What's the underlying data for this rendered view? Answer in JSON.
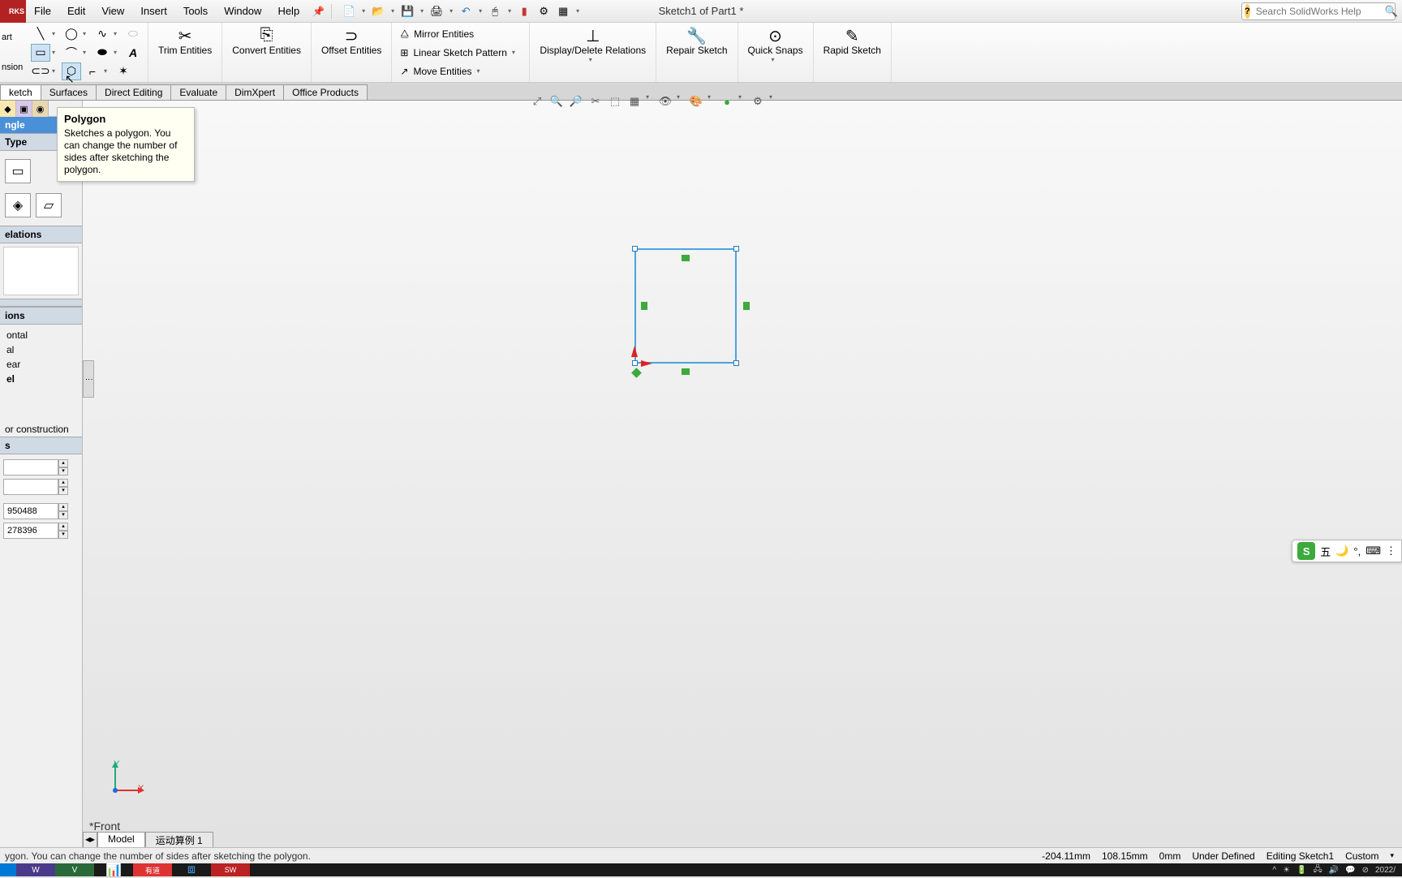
{
  "app": {
    "logo_text": "RKS",
    "document_title": "Sketch1 of Part1 *"
  },
  "menu": {
    "items": [
      "File",
      "Edit",
      "View",
      "Insert",
      "Tools",
      "Window",
      "Help"
    ]
  },
  "search": {
    "placeholder": "Search SolidWorks Help"
  },
  "ribbon": {
    "left_stub_top": "art",
    "left_stub_bottom": "nsion",
    "trim": "Trim Entities",
    "convert": "Convert Entities",
    "offset": "Offset Entities",
    "mirror": "Mirror Entities",
    "linear_pattern": "Linear Sketch Pattern",
    "move": "Move Entities",
    "display_delete": "Display/Delete Relations",
    "repair": "Repair Sketch",
    "quick_snaps": "Quick Snaps",
    "rapid": "Rapid Sketch"
  },
  "ribbon_tabs": [
    "ketch",
    "Surfaces",
    "Direct Editing",
    "Evaluate",
    "DimXpert",
    "Office Products"
  ],
  "tooltip": {
    "title": "Polygon",
    "body": "Sketches a polygon. You can change the number of sides after sketching the polygon."
  },
  "left_panel": {
    "header": "ngle",
    "type_section": "Type",
    "relations_section": "elations",
    "options_section": "ions",
    "opt_horizontal": "ontal",
    "opt_vertical": "al",
    "opt_near": "ear",
    "opt_del": "el",
    "construction": "or construction",
    "params_section": "s",
    "val1": "",
    "val2": "",
    "val3": "950488",
    "val4": "278396"
  },
  "viewport": {
    "view_label": "*Front",
    "triad_x": "X",
    "triad_y": "Y"
  },
  "bottom_tabs": {
    "model": "Model",
    "motion": "运动算例 1"
  },
  "status": {
    "hint": "ygon. You can change the number of sides after sketching the polygon.",
    "coord_x": "-204.11mm",
    "coord_y": "108.15mm",
    "coord_z": "0mm",
    "defined": "Under Defined",
    "editing": "Editing Sketch1",
    "custom": "Custom"
  },
  "ime": {
    "label": "五"
  },
  "taskbar": {
    "clock": "2022/"
  },
  "chart_data": null
}
